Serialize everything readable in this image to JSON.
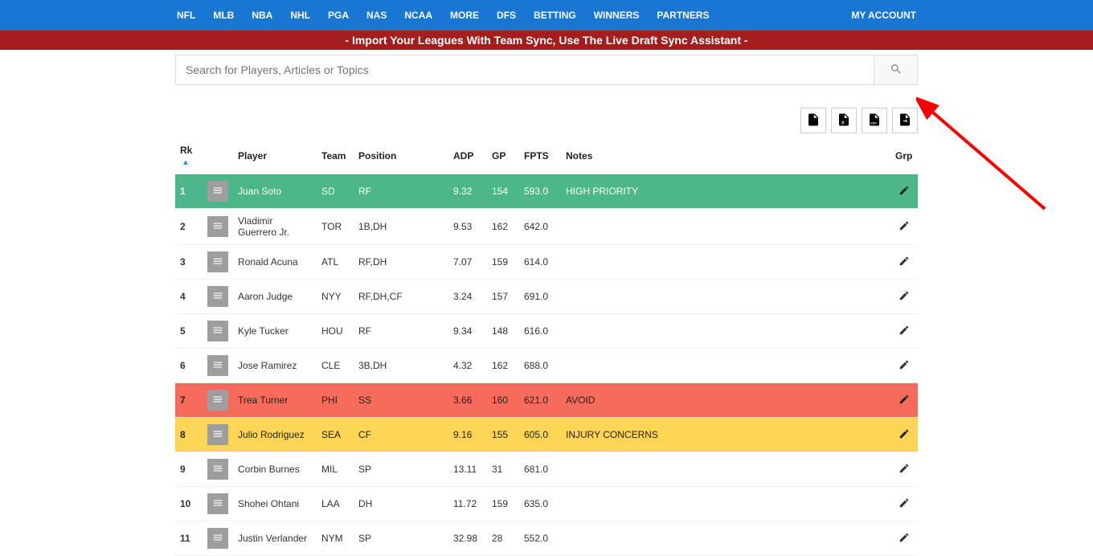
{
  "nav": {
    "items": [
      "NFL",
      "MLB",
      "NBA",
      "NHL",
      "PGA",
      "NAS",
      "NCAA",
      "MORE",
      "DFS",
      "BETTING",
      "WINNERS",
      "PARTNERS"
    ],
    "account": "MY ACCOUNT"
  },
  "banner": "- Import Your Leagues With Team Sync, Use The Live Draft Sync Assistant -",
  "search": {
    "placeholder": "Search for Players, Articles or Topics"
  },
  "table": {
    "headers": {
      "rk": "Rk",
      "player": "Player",
      "team": "Team",
      "position": "Position",
      "adp": "ADP",
      "gp": "GP",
      "fpts": "FPTS",
      "notes": "Notes",
      "grp": "Grp"
    },
    "rows": [
      {
        "rk": "1",
        "player": "Juan Soto",
        "team": "SD",
        "position": "RF",
        "adp": "9.32",
        "gp": "154",
        "fpts": "593.0",
        "notes": "HIGH PRIORITY",
        "style": "green"
      },
      {
        "rk": "2",
        "player": "Vladimir Guerrero Jr.",
        "team": "TOR",
        "position": "1B,DH",
        "adp": "9.53",
        "gp": "162",
        "fpts": "642.0",
        "notes": "",
        "style": ""
      },
      {
        "rk": "3",
        "player": "Ronald Acuna",
        "team": "ATL",
        "position": "RF,DH",
        "adp": "7.07",
        "gp": "159",
        "fpts": "614.0",
        "notes": "",
        "style": ""
      },
      {
        "rk": "4",
        "player": "Aaron Judge",
        "team": "NYY",
        "position": "RF,DH,CF",
        "adp": "3.24",
        "gp": "157",
        "fpts": "691.0",
        "notes": "",
        "style": ""
      },
      {
        "rk": "5",
        "player": "Kyle Tucker",
        "team": "HOU",
        "position": "RF",
        "adp": "9.34",
        "gp": "148",
        "fpts": "616.0",
        "notes": "",
        "style": ""
      },
      {
        "rk": "6",
        "player": "Jose Ramirez",
        "team": "CLE",
        "position": "3B,DH",
        "adp": "4.32",
        "gp": "162",
        "fpts": "688.0",
        "notes": "",
        "style": ""
      },
      {
        "rk": "7",
        "player": "Trea Turner",
        "team": "PHI",
        "position": "SS",
        "adp": "3.66",
        "gp": "160",
        "fpts": "621.0",
        "notes": "AVOID",
        "style": "red"
      },
      {
        "rk": "8",
        "player": "Julio Rodriguez",
        "team": "SEA",
        "position": "CF",
        "adp": "9.16",
        "gp": "155",
        "fpts": "605.0",
        "notes": "INJURY CONCERNS",
        "style": "yellow"
      },
      {
        "rk": "9",
        "player": "Corbin Burnes",
        "team": "MIL",
        "position": "SP",
        "adp": "13.11",
        "gp": "31",
        "fpts": "681.0",
        "notes": "",
        "style": ""
      },
      {
        "rk": "10",
        "player": "Shohei Ohtani",
        "team": "LAA",
        "position": "DH",
        "adp": "11.72",
        "gp": "159",
        "fpts": "635.0",
        "notes": "",
        "style": ""
      },
      {
        "rk": "11",
        "player": "Justin Verlander",
        "team": "NYM",
        "position": "SP",
        "adp": "32.98",
        "gp": "28",
        "fpts": "552.0",
        "notes": "",
        "style": ""
      }
    ]
  }
}
